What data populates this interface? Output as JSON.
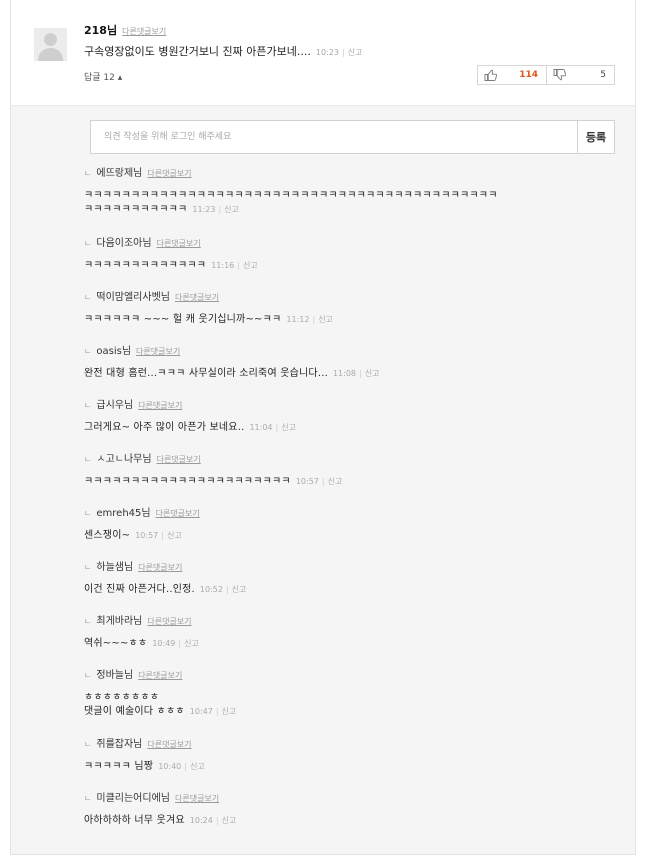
{
  "main_comment": {
    "author": "218님",
    "more_link": "다른댓글보기",
    "text": "구속영장없이도 병원간거보니 진짜 아픈가보네....",
    "time": "10:23",
    "report": "신고",
    "reply_toggle": "답글 12 ▴",
    "upvotes": "114",
    "downvotes": "5"
  },
  "reply_input": {
    "placeholder": "의견 작성을 위해 로그인 해주세요",
    "submit_label": "등록"
  },
  "replies": [
    {
      "author": "에뜨랑제님",
      "more": "다른댓글보기",
      "text": "ㅋㅋㅋㅋㅋㅋㅋㅋㅋㅋㅋㅋㅋㅋㅋㅋㅋㅋㅋㅋㅋㅋㅋㅋㅋㅋㅋㅋㅋㅋㅋㅋㅋㅋㅋㅋㅋㅋㅋㅋㅋㅋㅋㅋ\nㅋㅋㅋㅋㅋㅋㅋㅋㅋㅋㅋ",
      "time": "11:23",
      "report": "신고"
    },
    {
      "author": "다음이조아님",
      "more": "다른댓글보기",
      "text": "ㅋㅋㅋㅋㅋㅋㅋㅋㅋㅋㅋㅋㅋ",
      "time": "11:16",
      "report": "신고"
    },
    {
      "author": "떡이맘엘리사벳님",
      "more": "다른댓글보기",
      "text": "ㅋㅋㅋㅋㅋㅋ ~~~ 헐 캐 웃기십니까~~ㅋㅋ",
      "time": "11:12",
      "report": "신고"
    },
    {
      "author": "oasis님",
      "more": "다른댓글보기",
      "text": "완전 대형 홈런...ㅋㅋㅋ 사무실이라 소리죽여 웃습니다...",
      "time": "11:08",
      "report": "신고"
    },
    {
      "author": "급시우님",
      "more": "다른댓글보기",
      "text": "그러게요~ 아주 많이 아픈가 보네요..",
      "time": "11:04",
      "report": "신고"
    },
    {
      "author": "ㅅ고ㄴ나무님",
      "more": "다른댓글보기",
      "text": "ㅋㅋㅋㅋㅋㅋㅋㅋㅋㅋㅋㅋㅋㅋㅋㅋㅋㅋㅋㅋㅋㅋ",
      "time": "10:57",
      "report": "신고"
    },
    {
      "author": "emreh45님",
      "more": "다른댓글보기",
      "text": "센스쟁이~",
      "time": "10:57",
      "report": "신고"
    },
    {
      "author": "하늘샘님",
      "more": "다른댓글보기",
      "text": "이건 진짜 아픈거다..인정.",
      "time": "10:52",
      "report": "신고"
    },
    {
      "author": "최게바라님",
      "more": "다른댓글보기",
      "text": "역쉬~~~ㅎㅎ",
      "time": "10:49",
      "report": "신고"
    },
    {
      "author": "정바늘님",
      "more": "다른댓글보기",
      "text": "ㅎㅎㅎㅎㅎㅎㅎㅎ\n댓글이 예술이다 ㅎㅎㅎ",
      "time": "10:47",
      "report": "신고"
    },
    {
      "author": "쥐를잡자님",
      "more": "다른댓글보기",
      "text": "ㅋㅋㅋㅋㅋ 님짱",
      "time": "10:40",
      "report": "신고"
    },
    {
      "author": "미클리는어디에님",
      "more": "다른댓글보기",
      "text": "아하하하하 너무 웃겨요",
      "time": "10:24",
      "report": "신고"
    }
  ]
}
